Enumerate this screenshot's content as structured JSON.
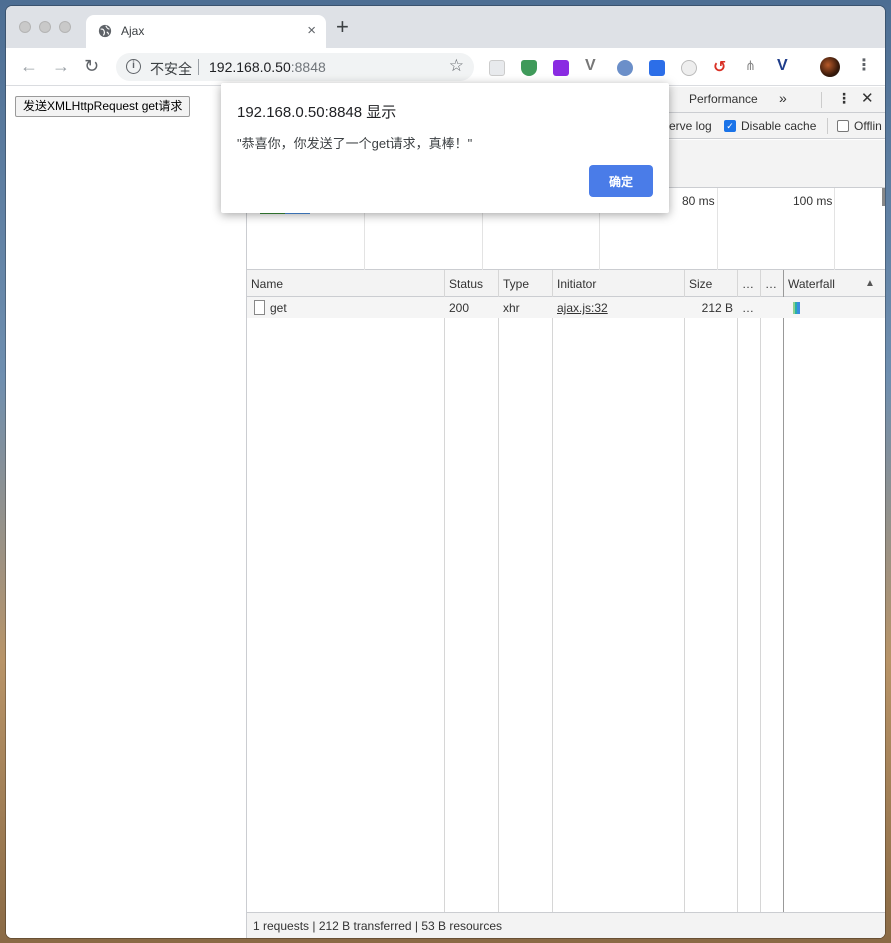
{
  "browser": {
    "tab_title": "Ajax",
    "tab_close_glyph": "×",
    "new_tab_glyph": "+",
    "security_label": "不安全",
    "url_host": "192.168.0.50",
    "url_port": ":8848"
  },
  "page": {
    "button_label": "发送XMLHttpRequest get请求"
  },
  "devtools": {
    "tabs": {
      "performance": "Performance",
      "more": "»"
    },
    "options": {
      "preserve_log": "erve log",
      "disable_cache": "Disable cache",
      "disable_cache_checked": true,
      "offline": "Offlin",
      "offline_checked": false
    },
    "overview_ticks": [
      "80 ms",
      "100 ms"
    ],
    "columns": [
      "Name",
      "Status",
      "Type",
      "Initiator",
      "Size",
      "…",
      "…",
      "Waterfall"
    ],
    "sort_indicator": "▲",
    "rows": [
      {
        "name": "get",
        "status": "200",
        "type": "xhr",
        "initiator": "ajax.js:32",
        "size": "212 B",
        "time": "…"
      }
    ],
    "status_bar": "1 requests | 212 B transferred | 53 B resources"
  },
  "alert": {
    "title": "192.168.0.50:8848 显示",
    "message": "\"恭喜你，你发送了一个get请求，真棒！\"",
    "ok_label": "确定"
  },
  "colors": {
    "accent": "#4a7ce8",
    "checkbox": "#1a73e8"
  },
  "icons": [
    "globe-icon",
    "back-icon",
    "forward-icon",
    "reload-icon",
    "info-icon",
    "star-icon",
    "kebab-icon",
    "file-icon"
  ]
}
